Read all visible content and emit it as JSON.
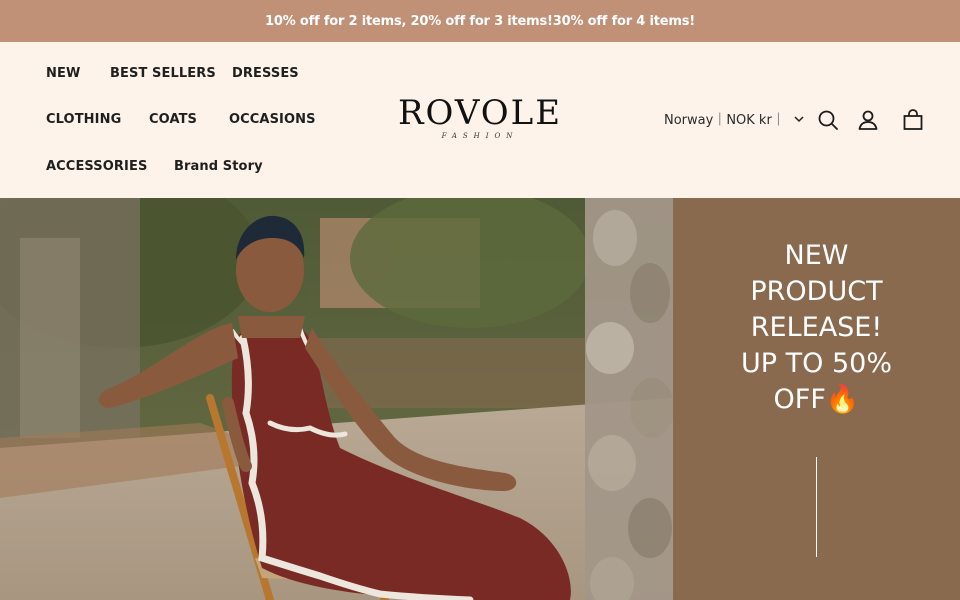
{
  "announcement": "10% off for 2 items, 20% off for 3 items!30% off for 4 items!",
  "nav": {
    "new": "NEW",
    "best_sellers": "BEST SELLERS",
    "dresses": "DRESSES",
    "clothing": "CLOTHING",
    "coats": "COATS",
    "occasions": "OCCASIONS",
    "accessories": "ACCESSORIES",
    "brand_story": "Brand Story"
  },
  "logo": {
    "name": "ROVOLE",
    "tagline": "FASHION"
  },
  "locale": {
    "label": "Norway｜NOK kr｜"
  },
  "icons": {
    "search": "search-icon",
    "account": "account-icon",
    "cart": "cart-icon",
    "chevron": "chevron-down-icon"
  },
  "hero": {
    "title": "NEW\nPRODUCT\nRELEASE!\nUP TO 50%\nOFF🔥"
  },
  "colors": {
    "announcement_bg": "#c09077",
    "header_bg": "#fdf3ea",
    "hero_panel_bg": "#8a6a4f",
    "dress": "#7a2a25"
  }
}
